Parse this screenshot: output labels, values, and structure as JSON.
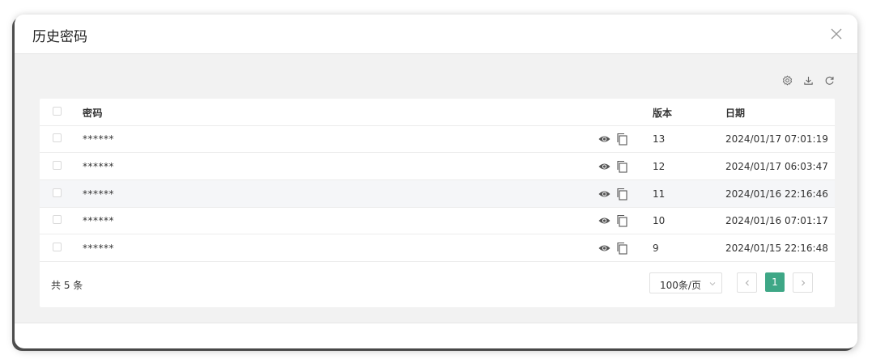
{
  "modal": {
    "title": "历史密码"
  },
  "table": {
    "headers": {
      "password": "密码",
      "version": "版本",
      "date": "日期"
    },
    "rows": [
      {
        "password": "******",
        "version": "13",
        "date": "2024/01/17 07:01:19"
      },
      {
        "password": "******",
        "version": "12",
        "date": "2024/01/17 06:03:47"
      },
      {
        "password": "******",
        "version": "11",
        "date": "2024/01/16 22:16:46"
      },
      {
        "password": "******",
        "version": "10",
        "date": "2024/01/16 07:01:17"
      },
      {
        "password": "******",
        "version": "9",
        "date": "2024/01/15 22:16:48"
      }
    ]
  },
  "pagination": {
    "total": "共 5 条",
    "page_size": "100条/页",
    "current_page": "1"
  },
  "toolbar": {
    "icons": [
      "settings-icon",
      "download-icon",
      "refresh-icon"
    ]
  },
  "colors": {
    "accent": "#3ea786",
    "body_bg": "#f2f2f2",
    "hover_row": "#f5f6f8"
  }
}
